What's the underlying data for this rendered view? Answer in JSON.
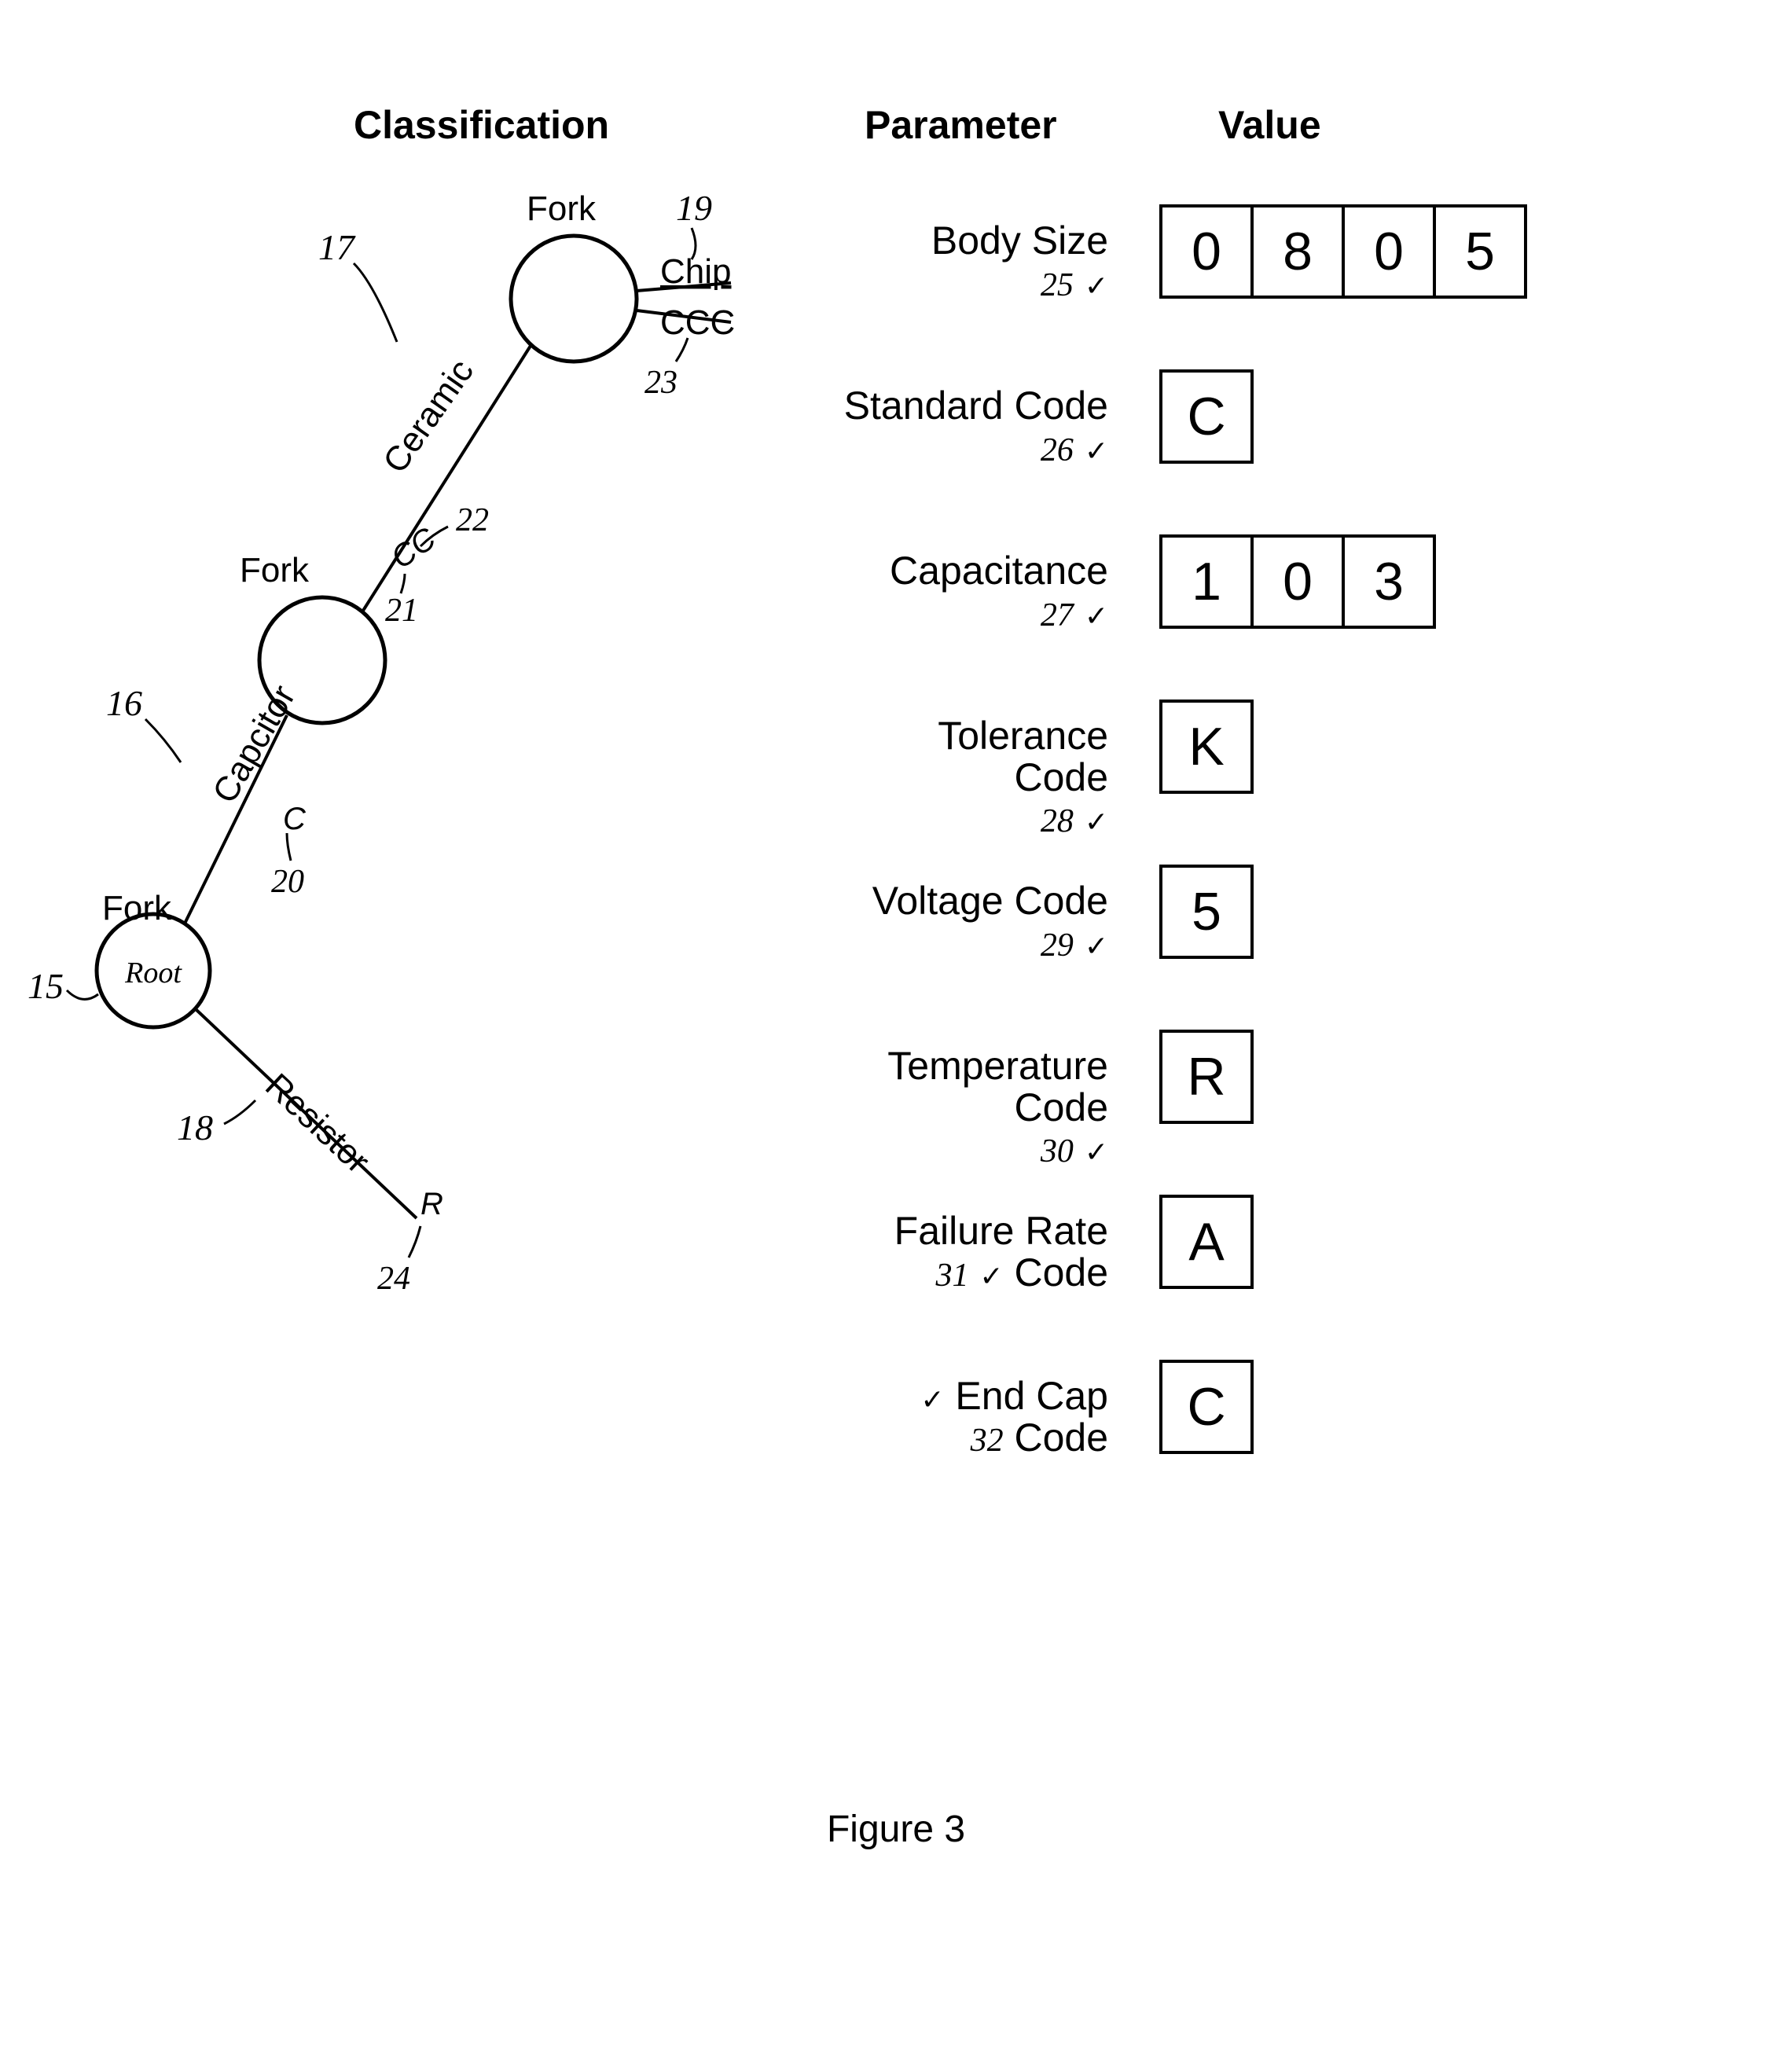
{
  "headers": {
    "classification": "Classification",
    "parameter": "Parameter",
    "value": "Value"
  },
  "caption": "Figure 3",
  "tree": {
    "root": {
      "label": "Root",
      "ref": "15",
      "fork": "Fork"
    },
    "branches": {
      "capacitor": {
        "label": "Capcitor",
        "code": "C",
        "ref_edge": "16",
        "ref_code": "20"
      },
      "resistor": {
        "label": "Resistor",
        "code": "R",
        "ref_edge": "18",
        "ref_code": "24"
      },
      "ceramic": {
        "label": "Ceramic",
        "code": "CC",
        "ref_edge": "17",
        "ref_code": "21",
        "ref_code_lead": "22"
      },
      "chip": {
        "label": "Chip",
        "ref_edge": "19"
      },
      "ccc": {
        "label": "CCC",
        "ref_code": "23"
      }
    },
    "forks": {
      "n2": "Fork",
      "n3": "Fork"
    }
  },
  "parameters": [
    {
      "name_a": "Body Size",
      "name_b": "",
      "ref": "25",
      "values": [
        "0",
        "8",
        "0",
        "5"
      ]
    },
    {
      "name_a": "Standard Code",
      "name_b": "",
      "ref": "26",
      "values": [
        "C"
      ]
    },
    {
      "name_a": "Capacitance",
      "name_b": "",
      "ref": "27",
      "values": [
        "1",
        "0",
        "3"
      ]
    },
    {
      "name_a": "Tolerance",
      "name_b": "Code",
      "ref": "28",
      "values": [
        "K"
      ]
    },
    {
      "name_a": "Voltage Code",
      "name_b": "",
      "ref": "29",
      "values": [
        "5"
      ]
    },
    {
      "name_a": "Temperature",
      "name_b": "Code",
      "ref": "30",
      "values": [
        "R"
      ]
    },
    {
      "name_a": "Failure Rate",
      "name_b": "Code",
      "ref": "31",
      "values": [
        "A"
      ]
    },
    {
      "name_a": "End Cap",
      "name_b": "Code",
      "ref": "32",
      "values": [
        "C"
      ]
    }
  ],
  "tick": "✓"
}
